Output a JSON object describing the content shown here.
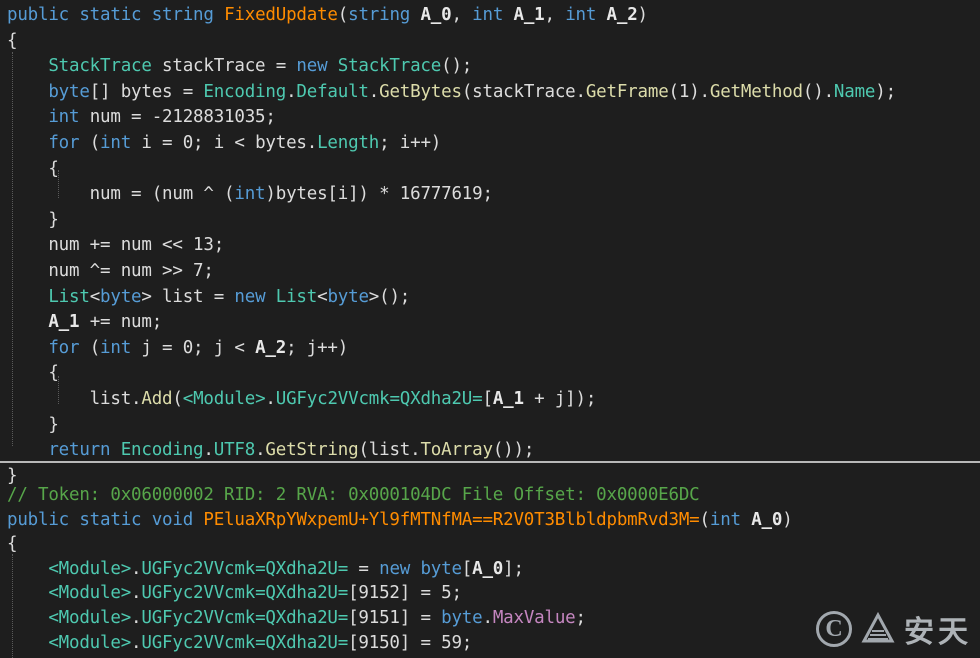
{
  "pane1": {
    "lines": [
      [
        [
          "public static string ",
          "kw"
        ],
        [
          "FixedUpdate",
          "mn"
        ],
        [
          "(",
          "p"
        ],
        [
          "string ",
          "kw"
        ],
        [
          "A_0",
          "pm"
        ],
        [
          ", ",
          "p"
        ],
        [
          "int ",
          "kw"
        ],
        [
          "A_1",
          "pm"
        ],
        [
          ", ",
          "p"
        ],
        [
          "int ",
          "kw"
        ],
        [
          "A_2",
          "pm"
        ],
        [
          ")",
          "p"
        ]
      ],
      [
        [
          "{",
          "p"
        ]
      ],
      [
        [
          "    ",
          "p"
        ],
        [
          "StackTrace",
          "ty"
        ],
        [
          " stackTrace = ",
          "p"
        ],
        [
          "new ",
          "kw"
        ],
        [
          "StackTrace",
          "ty"
        ],
        [
          "();",
          "p"
        ]
      ],
      [
        [
          "    ",
          "p"
        ],
        [
          "byte",
          "kw"
        ],
        [
          "[] bytes = ",
          "p"
        ],
        [
          "Encoding",
          "ty"
        ],
        [
          ".",
          "p"
        ],
        [
          "Default",
          "mb"
        ],
        [
          ".",
          "p"
        ],
        [
          "GetBytes",
          "fn"
        ],
        [
          "(stackTrace.",
          "p"
        ],
        [
          "GetFrame",
          "fn"
        ],
        [
          "(1).",
          "p"
        ],
        [
          "GetMethod",
          "fn"
        ],
        [
          "().",
          "p"
        ],
        [
          "Name",
          "mb"
        ],
        [
          ");",
          "p"
        ]
      ],
      [
        [
          "    ",
          "p"
        ],
        [
          "int ",
          "kw"
        ],
        [
          "num = -2128831035;",
          "p"
        ]
      ],
      [
        [
          "    ",
          "p"
        ],
        [
          "for ",
          "kw"
        ],
        [
          "(",
          "p"
        ],
        [
          "int ",
          "kw"
        ],
        [
          "i = 0; i < bytes.",
          "p"
        ],
        [
          "Length",
          "mb"
        ],
        [
          "; i++)",
          "p"
        ]
      ],
      [
        [
          "    {",
          "p"
        ]
      ],
      [
        [
          "        num = (num ^ (",
          "p"
        ],
        [
          "int",
          "kw"
        ],
        [
          ")bytes[i]) * 16777619;",
          "p"
        ]
      ],
      [
        [
          "    }",
          "p"
        ]
      ],
      [
        [
          "    num += num << 13;",
          "p"
        ]
      ],
      [
        [
          "    num ^= num >> 7;",
          "p"
        ]
      ],
      [
        [
          "    ",
          "p"
        ],
        [
          "List",
          "ty"
        ],
        [
          "<",
          "p"
        ],
        [
          "byte",
          "kw"
        ],
        [
          "> list = ",
          "p"
        ],
        [
          "new ",
          "kw"
        ],
        [
          "List",
          "ty"
        ],
        [
          "<",
          "p"
        ],
        [
          "byte",
          "kw"
        ],
        [
          ">();",
          "p"
        ]
      ],
      [
        [
          "    ",
          "p"
        ],
        [
          "A_1",
          "pm"
        ],
        [
          " += num;",
          "p"
        ]
      ],
      [
        [
          "    ",
          "p"
        ],
        [
          "for ",
          "kw"
        ],
        [
          "(",
          "p"
        ],
        [
          "int ",
          "kw"
        ],
        [
          "j = 0; j < ",
          "p"
        ],
        [
          "A_2",
          "pm"
        ],
        [
          "; j++)",
          "p"
        ]
      ],
      [
        [
          "    {",
          "p"
        ]
      ],
      [
        [
          "        list.",
          "p"
        ],
        [
          "Add",
          "fn"
        ],
        [
          "(",
          "p"
        ],
        [
          "<Module>",
          "ty"
        ],
        [
          ".",
          "p"
        ],
        [
          "UGFyc2VVcmk=QXdha2U=",
          "mb"
        ],
        [
          "[",
          "p"
        ],
        [
          "A_1",
          "pm"
        ],
        [
          " + j]);",
          "p"
        ]
      ],
      [
        [
          "    }",
          "p"
        ]
      ],
      [
        [
          "    ",
          "p"
        ],
        [
          "return ",
          "kw"
        ],
        [
          "Encoding",
          "ty"
        ],
        [
          ".",
          "p"
        ],
        [
          "UTF8",
          "mb"
        ],
        [
          ".",
          "p"
        ],
        [
          "GetString",
          "fn"
        ],
        [
          "(list.",
          "p"
        ],
        [
          "ToArray",
          "fn"
        ],
        [
          "());",
          "p"
        ]
      ],
      [
        [
          "}",
          "p"
        ]
      ]
    ]
  },
  "pane2": {
    "lines": [
      [
        [
          "// Token: 0x06000002 RID: 2 RVA: 0x000104DC File Offset: 0x0000E6DC",
          "cm"
        ]
      ],
      [
        [
          "public static void ",
          "kw"
        ],
        [
          "PEluaXRpYWxpemU+Yl9fMTNfMA==R2V0T3BlbldpbmRvd3M=",
          "mn"
        ],
        [
          "(",
          "p"
        ],
        [
          "int ",
          "kw"
        ],
        [
          "A_0",
          "pm"
        ],
        [
          ")",
          "p"
        ]
      ],
      [
        [
          "{",
          "p"
        ]
      ],
      [
        [
          "    ",
          "p"
        ],
        [
          "<Module>",
          "ty"
        ],
        [
          ".",
          "p"
        ],
        [
          "UGFyc2VVcmk=QXdha2U=",
          "mb"
        ],
        [
          " = ",
          "p"
        ],
        [
          "new ",
          "kw"
        ],
        [
          "byte",
          "kw"
        ],
        [
          "[",
          "p"
        ],
        [
          "A_0",
          "pm"
        ],
        [
          "];",
          "p"
        ]
      ],
      [
        [
          "    ",
          "p"
        ],
        [
          "<Module>",
          "ty"
        ],
        [
          ".",
          "p"
        ],
        [
          "UGFyc2VVcmk=QXdha2U=",
          "mb"
        ],
        [
          "[9152] = 5;",
          "p"
        ]
      ],
      [
        [
          "    ",
          "p"
        ],
        [
          "<Module>",
          "ty"
        ],
        [
          ".",
          "p"
        ],
        [
          "UGFyc2VVcmk=QXdha2U=",
          "mb"
        ],
        [
          "[9151] = ",
          "p"
        ],
        [
          "byte",
          "kw"
        ],
        [
          ".",
          "p"
        ],
        [
          "MaxValue",
          "pr"
        ],
        [
          ";",
          "p"
        ]
      ],
      [
        [
          "    ",
          "p"
        ],
        [
          "<Module>",
          "ty"
        ],
        [
          ".",
          "p"
        ],
        [
          "UGFyc2VVcmk=QXdha2U=",
          "mb"
        ],
        [
          "[9150] = 59;",
          "p"
        ]
      ]
    ]
  },
  "watermark": {
    "symbol": "C",
    "text": "安天",
    "icon": "antiy-logo-icon"
  },
  "colors": {
    "background": "#1e1e1e",
    "keyword": "#569cd6",
    "type": "#4ec9b0",
    "method": "#dcdcaa",
    "number": "#b5cea8",
    "comment": "#57a64a",
    "method_name": "#ff8c00"
  }
}
